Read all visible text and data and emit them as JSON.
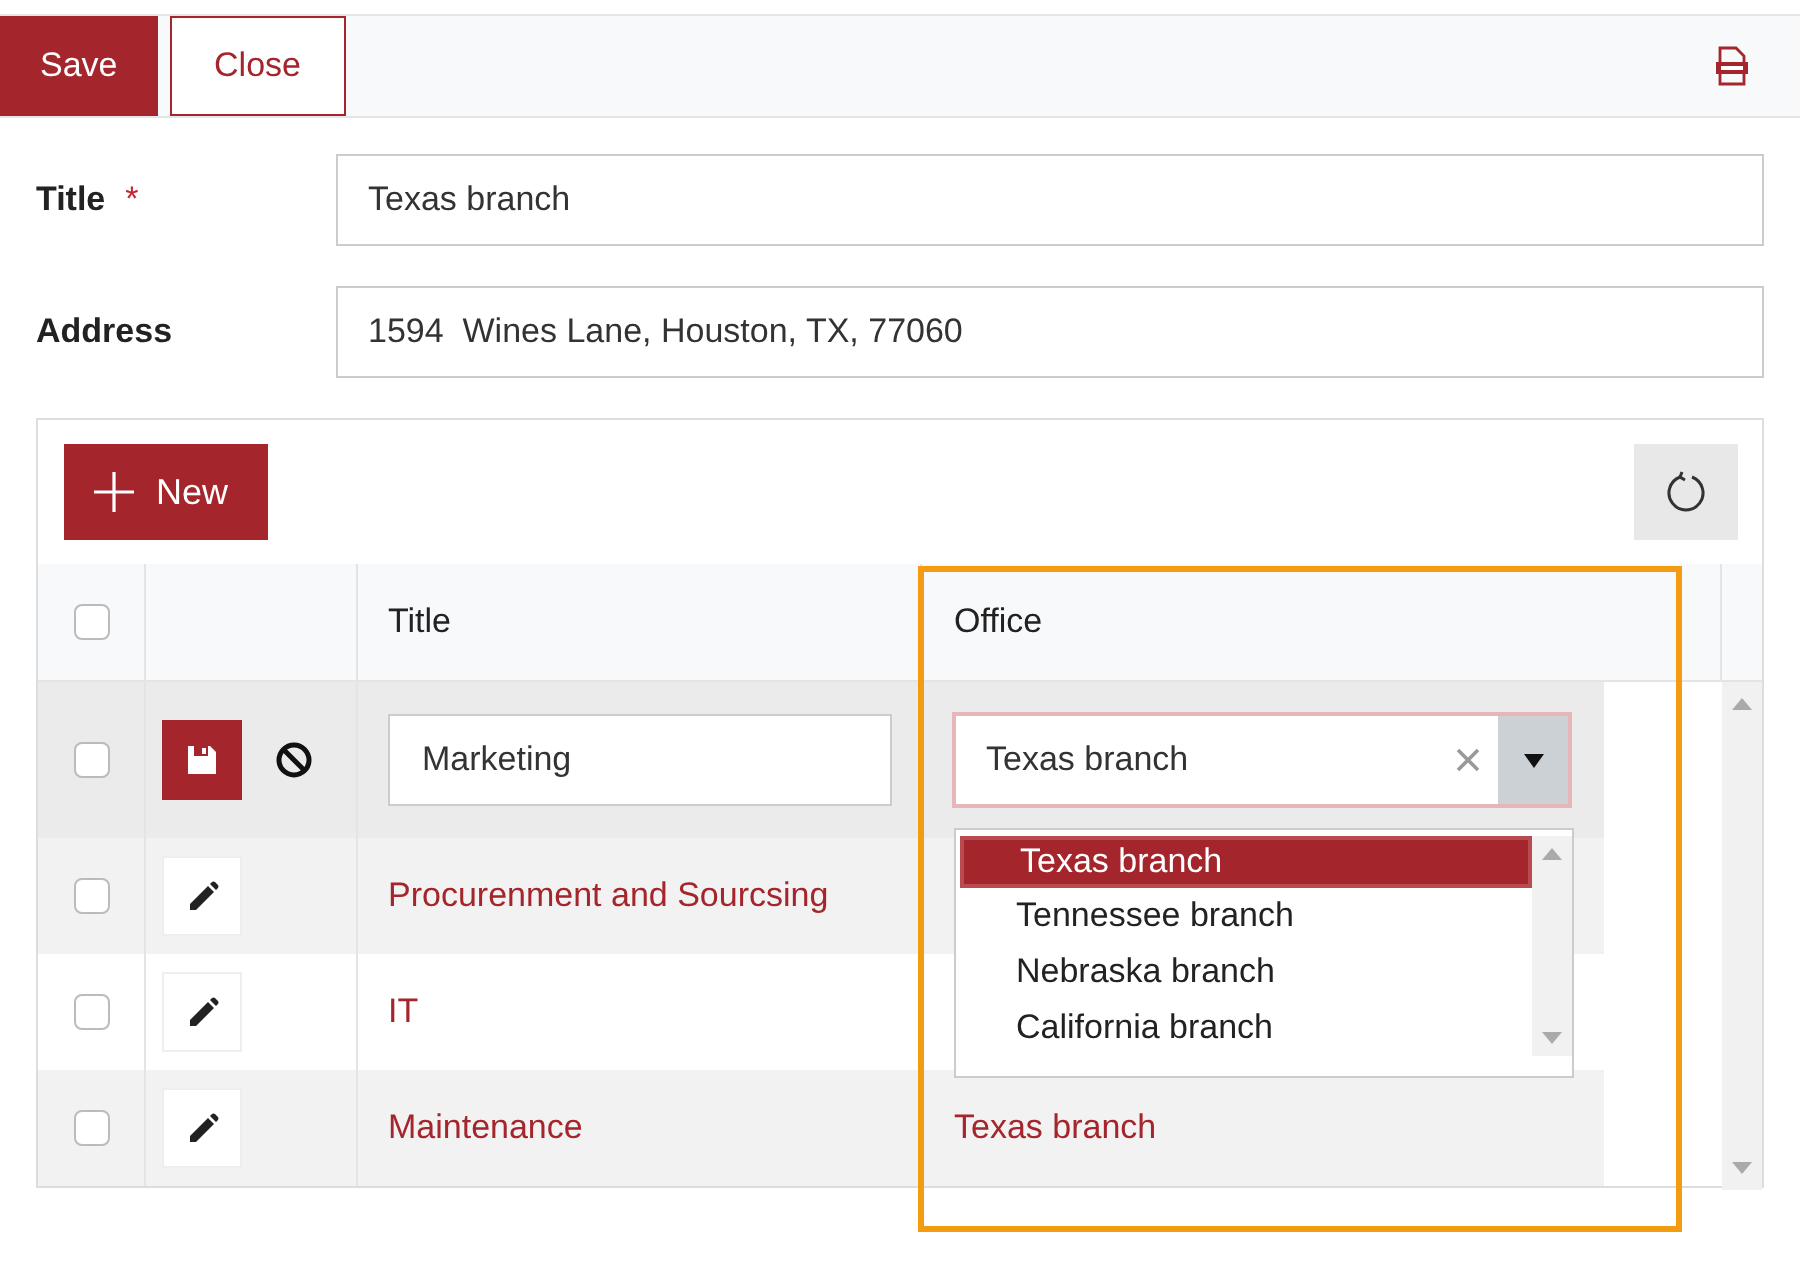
{
  "toolbar": {
    "buttons": [
      {
        "label": "Save",
        "kind": "primary"
      },
      {
        "label": "Close",
        "kind": "outline"
      }
    ]
  },
  "form": {
    "fields": [
      {
        "label": "Title",
        "required_mark": "*",
        "value": "Texas branch"
      },
      {
        "label": "Address",
        "value": "1594  Wines Lane, Houston, TX, 77060"
      }
    ]
  },
  "grid": {
    "new_button": "New",
    "header_checked": false,
    "columns": [
      "Title",
      "Office"
    ],
    "rows": [
      {
        "kind": "edit",
        "checked": false,
        "title": "Marketing",
        "office": "Texas branch"
      },
      {
        "kind": "view",
        "checked": false,
        "title": "Procurenment and Sourcsing"
      },
      {
        "kind": "view",
        "checked": false,
        "title": "IT"
      },
      {
        "kind": "view",
        "checked": false,
        "title": "Maintenance",
        "office": "Texas branch"
      }
    ],
    "dropdown": {
      "options": [
        {
          "label": "Texas branch",
          "selected": true
        },
        {
          "label": "Tennessee branch",
          "selected": false
        },
        {
          "label": "Nebraska branch",
          "selected": false
        },
        {
          "label": "California branch",
          "selected": false
        }
      ]
    }
  }
}
